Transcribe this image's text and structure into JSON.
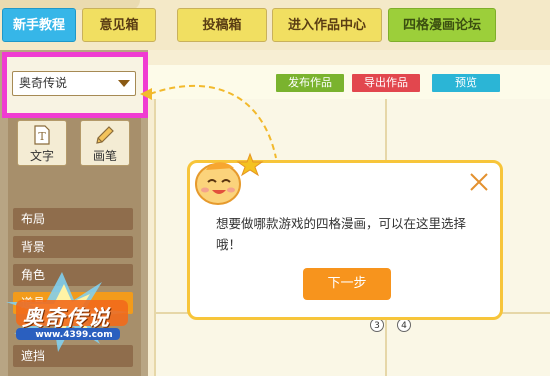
{
  "nav": {
    "items": [
      {
        "label": "新手教程",
        "style": "blue"
      },
      {
        "label": "意见箱",
        "style": "yellow"
      },
      {
        "label": "投稿箱",
        "style": "yellow"
      },
      {
        "label": "进入作品中心",
        "style": "yellow"
      },
      {
        "label": "四格漫画论坛",
        "style": "green"
      }
    ]
  },
  "sidebar": {
    "game_select": {
      "value": "奥奇传说"
    },
    "tools": [
      {
        "label": "文字",
        "icon": "text-icon"
      },
      {
        "label": "画笔",
        "icon": "pencil-icon"
      }
    ],
    "items": [
      {
        "label": "布局"
      },
      {
        "label": "背景"
      },
      {
        "label": "角色"
      },
      {
        "label": "道具"
      },
      {
        "label": "遮挡"
      }
    ]
  },
  "toolbar": {
    "publish_label": "发布作品",
    "export_label": "导出作品",
    "preview_label": "预览",
    "publish_color": "#7ab32e",
    "export_color": "#e2474e",
    "preview_color": "#2bb5d6"
  },
  "canvas": {
    "panel_numbers": [
      "3",
      "4"
    ]
  },
  "tip": {
    "text": "想要做哪款游戏的四格漫画，可以在这里选择哦！",
    "next_label": "下一步"
  },
  "logo": {
    "text": "奥奇传说",
    "site": "www.4399.com"
  }
}
